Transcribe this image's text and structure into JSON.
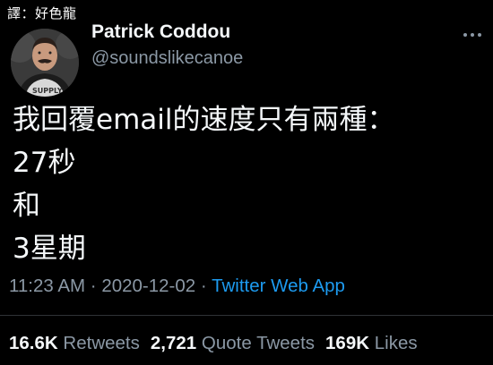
{
  "watermark": "譯：好色龍",
  "author": {
    "display_name": "Patrick Coddou",
    "handle": "@soundslikecanoe",
    "avatar_shirt_text": "SUPPLY"
  },
  "menu_icon": "more-dots-icon",
  "tweet": {
    "lines": [
      "我回覆email的速度只有兩種：",
      "27秒",
      "和",
      "3星期"
    ]
  },
  "meta": {
    "time": "11:23 AM",
    "separator": "·",
    "date": "2020-12-02",
    "source": "Twitter Web App"
  },
  "stats": {
    "retweets_count": "16.6K",
    "retweets_label": "Retweets",
    "quotes_count": "2,721",
    "quotes_label": "Quote Tweets",
    "likes_count": "169K",
    "likes_label": "Likes"
  },
  "colors": {
    "background": "#000000",
    "text": "#f5f8fa",
    "muted": "#8b98a5",
    "link": "#1d9bf0"
  }
}
